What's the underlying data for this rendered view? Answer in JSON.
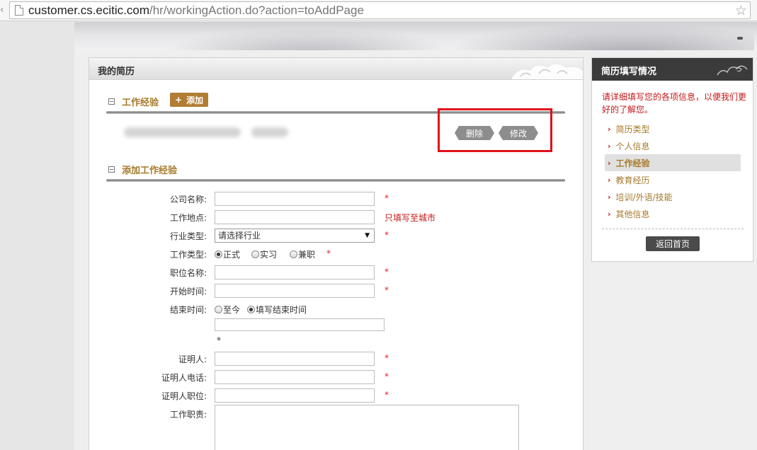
{
  "browser": {
    "url_host": "customer.cs.ecitic.com",
    "url_rest": "/hr/workingAction.do?action=toAddPage"
  },
  "main": {
    "title": "我的简历",
    "work_section": {
      "title": "工作经验",
      "add_label": "添加",
      "delete_label": "删除",
      "edit_label": "修改"
    },
    "add_section": {
      "title": "添加工作经验"
    },
    "form": {
      "company_label": "公司名称:",
      "location_label": "工作地点:",
      "location_hint": "只填写至城市",
      "industry_label": "行业类型:",
      "industry_selected": "请选择行业",
      "work_type_label": "工作类型:",
      "work_type_options": [
        "正式",
        "实习",
        "兼职"
      ],
      "work_type_selected": "正式",
      "position_label": "职位名称:",
      "start_label": "开始时间:",
      "end_label": "结束时间:",
      "end_options": [
        "至今",
        "填写结束时间"
      ],
      "end_selected": "填写结束时间",
      "referee_label": "证明人:",
      "referee_phone_label": "证明人电话:",
      "referee_position_label": "证明人职位:",
      "duties_label": "工作职责:",
      "required_mark": "*"
    }
  },
  "sidebar": {
    "title": "简历填写情况",
    "note": "请详细填写您的各项信息，以便我们更好的了解您。",
    "items": [
      {
        "label": "简历类型",
        "active": false
      },
      {
        "label": "个人信息",
        "active": false
      },
      {
        "label": "工作经验",
        "active": true
      },
      {
        "label": "教育经历",
        "active": false
      },
      {
        "label": "培训/外语/技能",
        "active": false
      },
      {
        "label": "其他信息",
        "active": false
      }
    ],
    "home_label": "返回首页"
  },
  "colors": {
    "accent_gold": "#a67a2b",
    "required_red": "#c21818",
    "highlight_red": "#e0101a"
  }
}
